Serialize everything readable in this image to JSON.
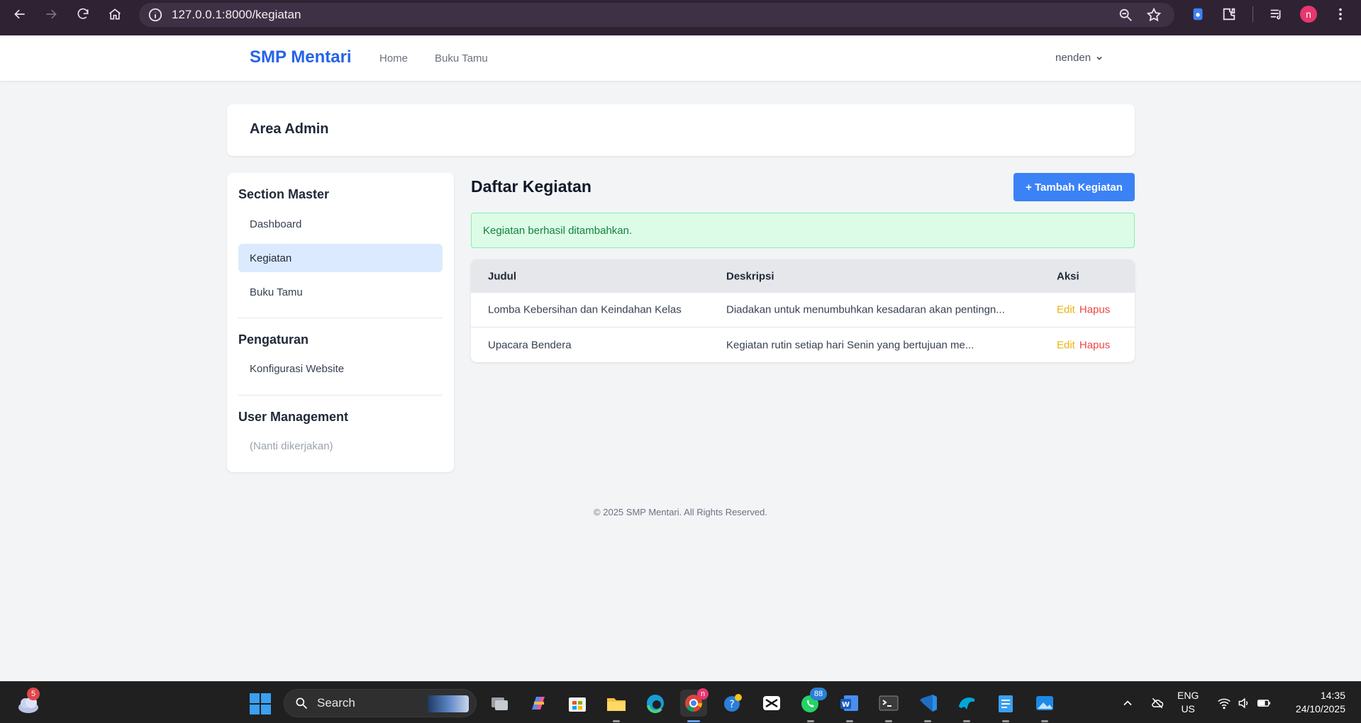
{
  "browser": {
    "url": "127.0.0.1:8000/kegiatan",
    "profile_initial": "n"
  },
  "site": {
    "brand": "SMP Mentari",
    "nav": [
      "Home",
      "Buku Tamu"
    ],
    "user": "nenden"
  },
  "admin_header": "Area Admin",
  "sidebar": {
    "sections": [
      {
        "title": "Section Master",
        "items": [
          "Dashboard",
          "Kegiatan",
          "Buku Tamu"
        ]
      },
      {
        "title": "Pengaturan",
        "items": [
          "Konfigurasi Website"
        ]
      },
      {
        "title": "User Management",
        "items": [
          "(Nanti dikerjakan)"
        ]
      }
    ],
    "active_item": "Kegiatan"
  },
  "main": {
    "title": "Daftar Kegiatan",
    "add_button": "+ Tambah Kegiatan",
    "alert": "Kegiatan berhasil ditambahkan.",
    "table": {
      "headers": [
        "Judul",
        "Deskripsi",
        "Aksi"
      ],
      "rows": [
        {
          "judul": "Lomba Kebersihan dan Keindahan Kelas",
          "deskripsi": "Diadakan untuk menumbuhkan kesadaran akan pentingn...",
          "edit": "Edit",
          "hapus": "Hapus"
        },
        {
          "judul": "Upacara Bendera",
          "deskripsi": "Kegiatan rutin setiap hari Senin yang bertujuan me...",
          "edit": "Edit",
          "hapus": "Hapus"
        }
      ]
    }
  },
  "footer": "© 2025 SMP Mentari. All Rights Reserved.",
  "taskbar": {
    "weather_badge": "5",
    "search_label": "Search",
    "whatsapp_badge": "88",
    "chrome_badge": "n",
    "lang_line1": "ENG",
    "lang_line2": "US",
    "time": "14:35",
    "date": "24/10/2025"
  },
  "colors": {
    "brand": "#2563eb",
    "primary_button": "#3b82f6",
    "alert_bg": "#dcfce7",
    "alert_text": "#15803d",
    "edit": "#eab308",
    "hapus": "#ef4444"
  }
}
